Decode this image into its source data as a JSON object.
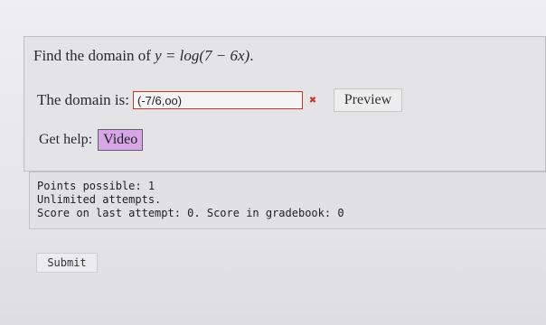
{
  "question": {
    "prompt_prefix": "Find the domain of ",
    "prompt_math": "y = log(7 − 6x)",
    "prompt_suffix": ".",
    "answer_label": "The domain is:",
    "answer_value": "(-7/6,oo)",
    "answer_status_icon": "incorrect-x-icon",
    "preview_label": "Preview",
    "help_label": "Get help:",
    "video_label": "Video"
  },
  "info": {
    "points_possible": "Points possible: 1",
    "attempts": "Unlimited attempts.",
    "score": "Score on last attempt: 0. Score in gradebook: 0"
  },
  "actions": {
    "submit_label": "Submit"
  },
  "colors": {
    "incorrect_border": "#c0392b",
    "video_button_bg": "#d6a6e6"
  }
}
